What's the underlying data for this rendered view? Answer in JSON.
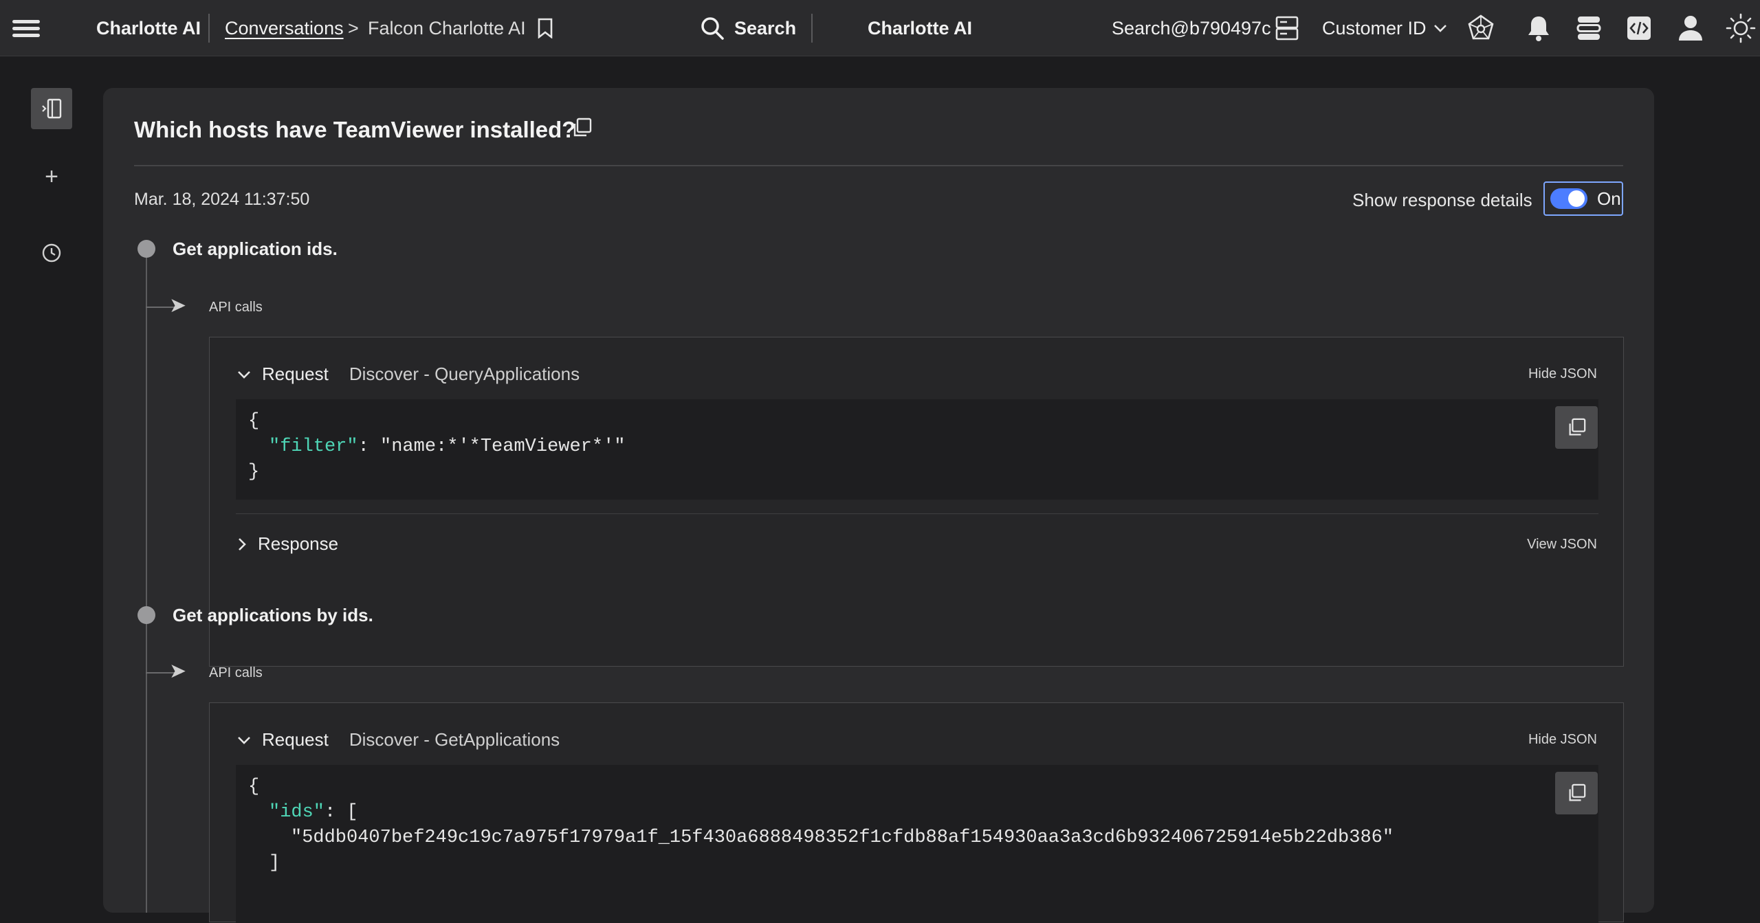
{
  "topbar": {
    "brand": "Charlotte AI",
    "breadcrumb_link": "Conversations",
    "breadcrumb_sep": ">",
    "breadcrumb_current": "Falcon Charlotte AI",
    "search_label": "Search",
    "center_title": "Charlotte AI",
    "user": "Search@b790497c",
    "customer_label": "Customer ID"
  },
  "conversation": {
    "question": "Which hosts have TeamViewer installed?",
    "timestamp": "Mar. 18, 2024 11:37:50",
    "show_details_label": "Show response details",
    "toggle_state": "On"
  },
  "steps": [
    {
      "title": "Get application ids.",
      "api_label": "API calls",
      "request_kind": "Request",
      "request_name": "Discover - QueryApplications",
      "request_action": "Hide JSON",
      "code": {
        "open": "{",
        "key": "\"filter\"",
        "colon": ": ",
        "value": "\"name:*'*TeamViewer*'\"",
        "close": "}"
      },
      "response_kind": "Response",
      "response_action": "View JSON"
    },
    {
      "title": "Get applications by ids.",
      "api_label": "API calls",
      "request_kind": "Request",
      "request_name": "Discover - GetApplications",
      "request_action": "Hide JSON",
      "code": {
        "open": "{",
        "key": "\"ids\"",
        "colon": ": [",
        "value": "\"5ddb0407bef249c19c7a975f17979a1f_15f430a6888498352f1cfdb88af154930aa3a3cd6b932406725914e5b22db386\"",
        "close": "]"
      }
    }
  ]
}
